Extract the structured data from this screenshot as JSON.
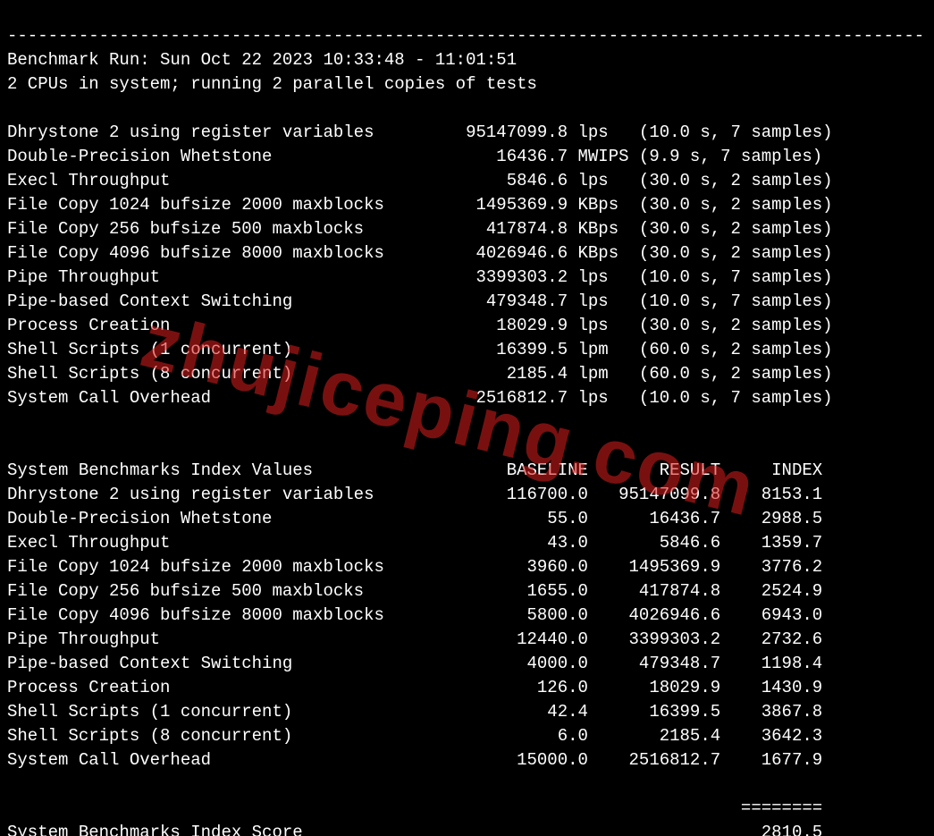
{
  "watermark": "zhujiceping.com",
  "divider": "------------------------------------------------------------------------------------------",
  "header": {
    "run": "Benchmark Run: Sun Oct 22 2023 10:33:48 - 11:01:51",
    "cpus": "2 CPUs in system; running 2 parallel copies of tests"
  },
  "results": [
    {
      "name": "Dhrystone 2 using register variables",
      "value": "95147099.8",
      "unit": "lps",
      "timing": "(10.0 s, 7 samples)"
    },
    {
      "name": "Double-Precision Whetstone",
      "value": "16436.7",
      "unit": "MWIPS",
      "timing": "(9.9 s, 7 samples)"
    },
    {
      "name": "Execl Throughput",
      "value": "5846.6",
      "unit": "lps",
      "timing": "(30.0 s, 2 samples)"
    },
    {
      "name": "File Copy 1024 bufsize 2000 maxblocks",
      "value": "1495369.9",
      "unit": "KBps",
      "timing": "(30.0 s, 2 samples)"
    },
    {
      "name": "File Copy 256 bufsize 500 maxblocks",
      "value": "417874.8",
      "unit": "KBps",
      "timing": "(30.0 s, 2 samples)"
    },
    {
      "name": "File Copy 4096 bufsize 8000 maxblocks",
      "value": "4026946.6",
      "unit": "KBps",
      "timing": "(30.0 s, 2 samples)"
    },
    {
      "name": "Pipe Throughput",
      "value": "3399303.2",
      "unit": "lps",
      "timing": "(10.0 s, 7 samples)"
    },
    {
      "name": "Pipe-based Context Switching",
      "value": "479348.7",
      "unit": "lps",
      "timing": "(10.0 s, 7 samples)"
    },
    {
      "name": "Process Creation",
      "value": "18029.9",
      "unit": "lps",
      "timing": "(30.0 s, 2 samples)"
    },
    {
      "name": "Shell Scripts (1 concurrent)",
      "value": "16399.5",
      "unit": "lpm",
      "timing": "(60.0 s, 2 samples)"
    },
    {
      "name": "Shell Scripts (8 concurrent)",
      "value": "2185.4",
      "unit": "lpm",
      "timing": "(60.0 s, 2 samples)"
    },
    {
      "name": "System Call Overhead",
      "value": "2516812.7",
      "unit": "lps",
      "timing": "(10.0 s, 7 samples)"
    }
  ],
  "index_header": {
    "title": "System Benchmarks Index Values",
    "baseline": "BASELINE",
    "result": "RESULT",
    "index": "INDEX"
  },
  "index": [
    {
      "name": "Dhrystone 2 using register variables",
      "baseline": "116700.0",
      "result": "95147099.8",
      "index": "8153.1"
    },
    {
      "name": "Double-Precision Whetstone",
      "baseline": "55.0",
      "result": "16436.7",
      "index": "2988.5"
    },
    {
      "name": "Execl Throughput",
      "baseline": "43.0",
      "result": "5846.6",
      "index": "1359.7"
    },
    {
      "name": "File Copy 1024 bufsize 2000 maxblocks",
      "baseline": "3960.0",
      "result": "1495369.9",
      "index": "3776.2"
    },
    {
      "name": "File Copy 256 bufsize 500 maxblocks",
      "baseline": "1655.0",
      "result": "417874.8",
      "index": "2524.9"
    },
    {
      "name": "File Copy 4096 bufsize 8000 maxblocks",
      "baseline": "5800.0",
      "result": "4026946.6",
      "index": "6943.0"
    },
    {
      "name": "Pipe Throughput",
      "baseline": "12440.0",
      "result": "3399303.2",
      "index": "2732.6"
    },
    {
      "name": "Pipe-based Context Switching",
      "baseline": "4000.0",
      "result": "479348.7",
      "index": "1198.4"
    },
    {
      "name": "Process Creation",
      "baseline": "126.0",
      "result": "18029.9",
      "index": "1430.9"
    },
    {
      "name": "Shell Scripts (1 concurrent)",
      "baseline": "42.4",
      "result": "16399.5",
      "index": "3867.8"
    },
    {
      "name": "Shell Scripts (8 concurrent)",
      "baseline": "6.0",
      "result": "2185.4",
      "index": "3642.3"
    },
    {
      "name": "System Call Overhead",
      "baseline": "15000.0",
      "result": "2516812.7",
      "index": "1677.9"
    }
  ],
  "separator": "========",
  "score": {
    "label": "System Benchmarks Index Score",
    "value": "2810.5"
  }
}
